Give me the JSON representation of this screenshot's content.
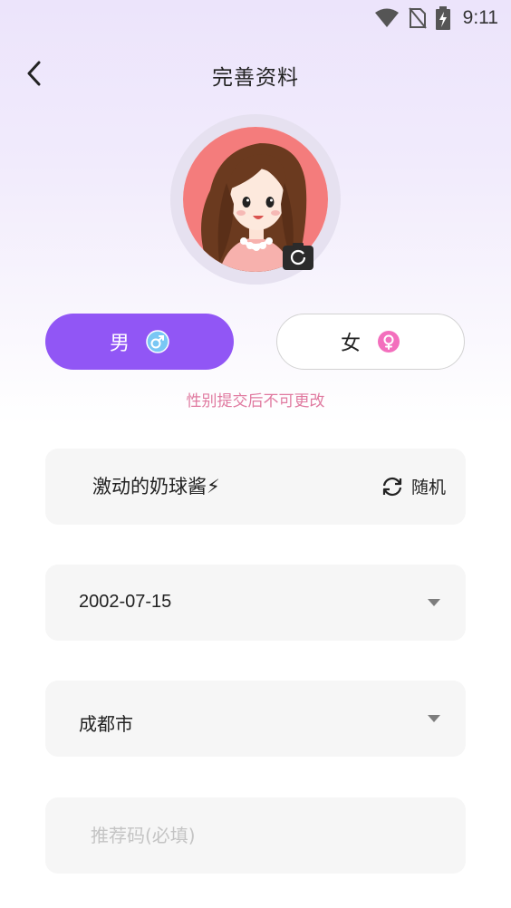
{
  "status_bar": {
    "time": "9:11",
    "icons": [
      "wifi-icon",
      "no-sim-icon",
      "battery-charging-icon"
    ]
  },
  "header": {
    "title": "完善资料",
    "back_icon": "chevron-left-icon"
  },
  "avatar": {
    "camera_icon": "camera-icon"
  },
  "gender": {
    "male_label": "男",
    "female_label": "女",
    "selected": "male",
    "male_icon": "male-symbol-icon",
    "female_icon": "female-symbol-icon",
    "note": "性别提交后不可更改"
  },
  "nickname": {
    "value": "激动的奶球酱⚡",
    "random_label": "随机",
    "random_icon": "refresh-icon"
  },
  "birthday": {
    "value": "2002-07-15"
  },
  "city": {
    "value": "成都市"
  },
  "referral": {
    "placeholder": "推荐码(必填)",
    "value": ""
  },
  "colors": {
    "accent": "#9156F5",
    "note": "#E07AA0",
    "field_bg": "#F6F6F6"
  }
}
